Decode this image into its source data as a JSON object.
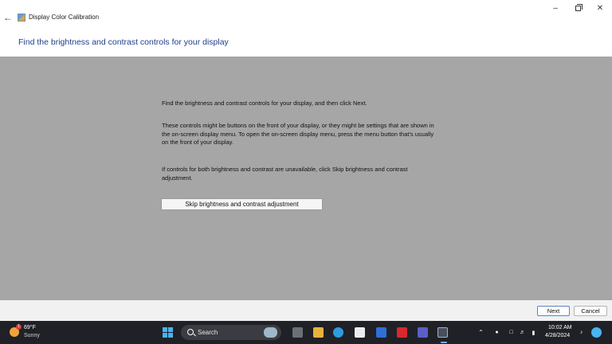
{
  "window": {
    "title": "Display Color Calibration",
    "back_icon": "back-arrow-icon",
    "controls": {
      "minimize": "–",
      "close": "✕"
    }
  },
  "page": {
    "heading": "Find the brightness and contrast controls for your display"
  },
  "content": {
    "paragraphs": [
      "Find the brightness and contrast controls for your display, and then click Next.",
      "These controls might be buttons on the front of your display, or they might be settings that are shown in the on-screen display menu. To open the on-screen display menu, press the menu button that's usually on the front of your display.",
      "If controls for both brightness and contrast are unavailable, click Skip brightness and contrast adjustment."
    ],
    "skip_button": "Skip brightness and contrast adjustment"
  },
  "footer": {
    "next_label": "Next",
    "cancel_label": "Cancel"
  },
  "taskbar": {
    "weather": {
      "temperature": "69°F",
      "condition": "Sunny",
      "badge": "1"
    },
    "search_label": "Search",
    "clock": {
      "time": "10:02 AM",
      "date": "4/28/2024"
    },
    "accent_color": "#6fb0f0"
  }
}
